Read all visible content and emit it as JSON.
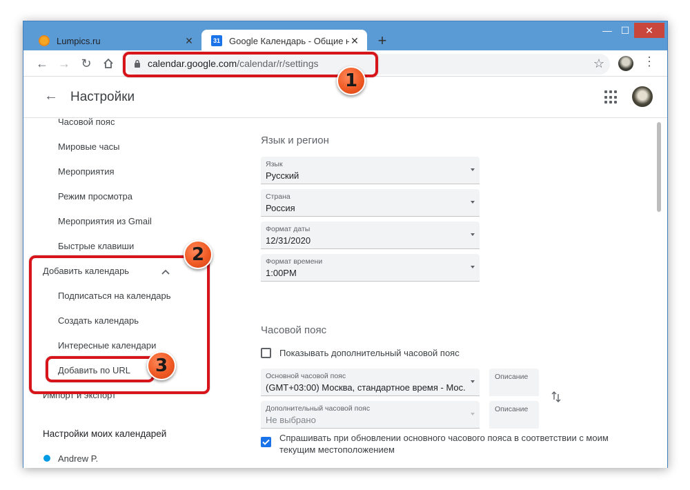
{
  "window": {
    "controls": {
      "minimize": "—",
      "maximize": "☐",
      "close": "✕"
    }
  },
  "tabs": [
    {
      "title": "Lumpics.ru",
      "favicon": "orange-circle-icon",
      "active": false
    },
    {
      "title": "Google Календарь - Общие нас",
      "favicon": "google-calendar-icon",
      "favicon_text": "31",
      "active": true
    }
  ],
  "toolbar": {
    "url_host": "calendar.google.com",
    "url_path": "/calendar/r/settings"
  },
  "appbar": {
    "title": "Настройки"
  },
  "sidebar": {
    "items": [
      {
        "label": "Часовой пояс"
      },
      {
        "label": "Мировые часы"
      },
      {
        "label": "Мероприятия"
      },
      {
        "label": "Режим просмотра"
      },
      {
        "label": "Мероприятия из Gmail"
      },
      {
        "label": "Быстрые клавиши"
      }
    ],
    "add_calendar": "Добавить календарь",
    "add_calendar_items": [
      {
        "label": "Подписаться на календарь"
      },
      {
        "label": "Создать календарь"
      },
      {
        "label": "Интересные календари"
      },
      {
        "label": "Добавить по URL"
      }
    ],
    "import_export": "Импорт и экспорт",
    "my_calendars_heading": "Настройки моих календарей",
    "my_calendar_name": "Andrew P.",
    "my_calendar_color": "#039be5"
  },
  "language_region": {
    "title": "Язык и регион",
    "language_label": "Язык",
    "language_value": "Русский",
    "country_label": "Страна",
    "country_value": "Россия",
    "date_format_label": "Формат даты",
    "date_format_value": "12/31/2020",
    "time_format_label": "Формат времени",
    "time_format_value": "1:00PM"
  },
  "timezone": {
    "title": "Часовой пояс",
    "show_secondary_label": "Показывать дополнительный часовой пояс",
    "show_secondary_checked": false,
    "primary_label": "Основной часовой пояс",
    "primary_value": "(GMT+03:00) Москва, стандартное время - Мос...",
    "primary_desc_label": "Описание",
    "secondary_label": "Дополнительный часовой пояс",
    "secondary_value": "Не выбрано",
    "secondary_desc_label": "Описание",
    "ask_update_label_line1": "Спрашивать при обновлении основного часового пояса в соответствии с моим",
    "ask_update_label_line2": "текущим местоположением",
    "ask_update_checked": true
  },
  "annotations": {
    "badge_1": "1",
    "badge_2": "2",
    "badge_3": "3",
    "color": "#d7141a"
  },
  "colors": {
    "window_frame": "#5b9bd5",
    "accent": "#1a73e8"
  }
}
